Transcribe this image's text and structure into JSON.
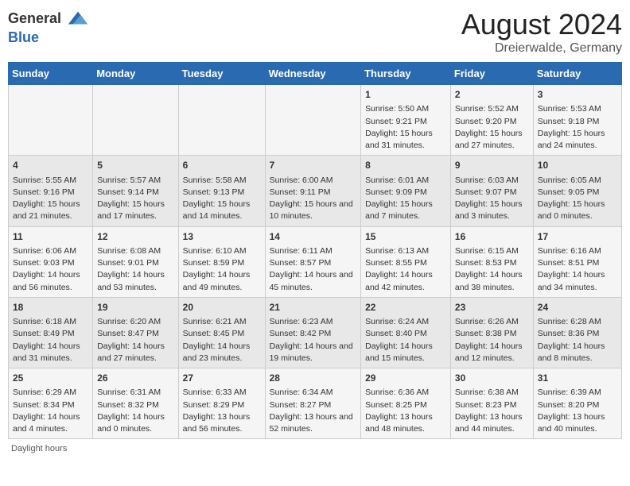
{
  "header": {
    "logo_line1": "General",
    "logo_line2": "Blue",
    "month": "August 2024",
    "location": "Dreierwalde, Germany"
  },
  "days_of_week": [
    "Sunday",
    "Monday",
    "Tuesday",
    "Wednesday",
    "Thursday",
    "Friday",
    "Saturday"
  ],
  "weeks": [
    [
      {
        "day": "",
        "sunrise": "",
        "sunset": "",
        "daylight": ""
      },
      {
        "day": "",
        "sunrise": "",
        "sunset": "",
        "daylight": ""
      },
      {
        "day": "",
        "sunrise": "",
        "sunset": "",
        "daylight": ""
      },
      {
        "day": "",
        "sunrise": "",
        "sunset": "",
        "daylight": ""
      },
      {
        "day": "1",
        "sunrise": "5:50 AM",
        "sunset": "9:21 PM",
        "daylight": "15 hours and 31 minutes."
      },
      {
        "day": "2",
        "sunrise": "5:52 AM",
        "sunset": "9:20 PM",
        "daylight": "15 hours and 27 minutes."
      },
      {
        "day": "3",
        "sunrise": "5:53 AM",
        "sunset": "9:18 PM",
        "daylight": "15 hours and 24 minutes."
      }
    ],
    [
      {
        "day": "4",
        "sunrise": "5:55 AM",
        "sunset": "9:16 PM",
        "daylight": "15 hours and 21 minutes."
      },
      {
        "day": "5",
        "sunrise": "5:57 AM",
        "sunset": "9:14 PM",
        "daylight": "15 hours and 17 minutes."
      },
      {
        "day": "6",
        "sunrise": "5:58 AM",
        "sunset": "9:13 PM",
        "daylight": "15 hours and 14 minutes."
      },
      {
        "day": "7",
        "sunrise": "6:00 AM",
        "sunset": "9:11 PM",
        "daylight": "15 hours and 10 minutes."
      },
      {
        "day": "8",
        "sunrise": "6:01 AM",
        "sunset": "9:09 PM",
        "daylight": "15 hours and 7 minutes."
      },
      {
        "day": "9",
        "sunrise": "6:03 AM",
        "sunset": "9:07 PM",
        "daylight": "15 hours and 3 minutes."
      },
      {
        "day": "10",
        "sunrise": "6:05 AM",
        "sunset": "9:05 PM",
        "daylight": "15 hours and 0 minutes."
      }
    ],
    [
      {
        "day": "11",
        "sunrise": "6:06 AM",
        "sunset": "9:03 PM",
        "daylight": "14 hours and 56 minutes."
      },
      {
        "day": "12",
        "sunrise": "6:08 AM",
        "sunset": "9:01 PM",
        "daylight": "14 hours and 53 minutes."
      },
      {
        "day": "13",
        "sunrise": "6:10 AM",
        "sunset": "8:59 PM",
        "daylight": "14 hours and 49 minutes."
      },
      {
        "day": "14",
        "sunrise": "6:11 AM",
        "sunset": "8:57 PM",
        "daylight": "14 hours and 45 minutes."
      },
      {
        "day": "15",
        "sunrise": "6:13 AM",
        "sunset": "8:55 PM",
        "daylight": "14 hours and 42 minutes."
      },
      {
        "day": "16",
        "sunrise": "6:15 AM",
        "sunset": "8:53 PM",
        "daylight": "14 hours and 38 minutes."
      },
      {
        "day": "17",
        "sunrise": "6:16 AM",
        "sunset": "8:51 PM",
        "daylight": "14 hours and 34 minutes."
      }
    ],
    [
      {
        "day": "18",
        "sunrise": "6:18 AM",
        "sunset": "8:49 PM",
        "daylight": "14 hours and 31 minutes."
      },
      {
        "day": "19",
        "sunrise": "6:20 AM",
        "sunset": "8:47 PM",
        "daylight": "14 hours and 27 minutes."
      },
      {
        "day": "20",
        "sunrise": "6:21 AM",
        "sunset": "8:45 PM",
        "daylight": "14 hours and 23 minutes."
      },
      {
        "day": "21",
        "sunrise": "6:23 AM",
        "sunset": "8:42 PM",
        "daylight": "14 hours and 19 minutes."
      },
      {
        "day": "22",
        "sunrise": "6:24 AM",
        "sunset": "8:40 PM",
        "daylight": "14 hours and 15 minutes."
      },
      {
        "day": "23",
        "sunrise": "6:26 AM",
        "sunset": "8:38 PM",
        "daylight": "14 hours and 12 minutes."
      },
      {
        "day": "24",
        "sunrise": "6:28 AM",
        "sunset": "8:36 PM",
        "daylight": "14 hours and 8 minutes."
      }
    ],
    [
      {
        "day": "25",
        "sunrise": "6:29 AM",
        "sunset": "8:34 PM",
        "daylight": "14 hours and 4 minutes."
      },
      {
        "day": "26",
        "sunrise": "6:31 AM",
        "sunset": "8:32 PM",
        "daylight": "14 hours and 0 minutes."
      },
      {
        "day": "27",
        "sunrise": "6:33 AM",
        "sunset": "8:29 PM",
        "daylight": "13 hours and 56 minutes."
      },
      {
        "day": "28",
        "sunrise": "6:34 AM",
        "sunset": "8:27 PM",
        "daylight": "13 hours and 52 minutes."
      },
      {
        "day": "29",
        "sunrise": "6:36 AM",
        "sunset": "8:25 PM",
        "daylight": "13 hours and 48 minutes."
      },
      {
        "day": "30",
        "sunrise": "6:38 AM",
        "sunset": "8:23 PM",
        "daylight": "13 hours and 44 minutes."
      },
      {
        "day": "31",
        "sunrise": "6:39 AM",
        "sunset": "8:20 PM",
        "daylight": "13 hours and 40 minutes."
      }
    ]
  ],
  "footer": "Daylight hours"
}
